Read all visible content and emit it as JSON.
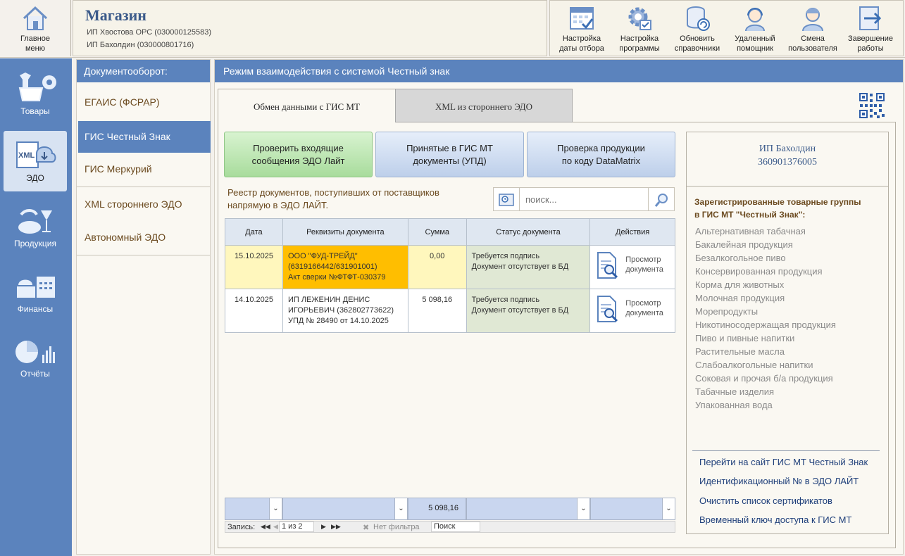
{
  "header": {
    "home_label": "Главное меню",
    "shop_title": "Магазин",
    "entity1": "ИП Хвостова ОРС (030000125583)",
    "entity2": "ИП Бахолдин (030000801716)",
    "toolbar": [
      {
        "label": "Настройка даты отбора",
        "icon": "calendar-icon"
      },
      {
        "label": "Настройка программы",
        "icon": "gear-icon"
      },
      {
        "label": "Обновить справочники",
        "icon": "database-refresh-icon"
      },
      {
        "label": "Удаленный помощник",
        "icon": "support-agent-icon"
      },
      {
        "label": "Смена пользователя",
        "icon": "user-switch-icon"
      },
      {
        "label": "Завершение работы",
        "icon": "exit-arrow-icon"
      }
    ]
  },
  "leftnav": [
    {
      "label": "Товары",
      "icon": "goods-basket-icon",
      "active": false
    },
    {
      "label": "ЭДО",
      "icon": "xml-edo-icon",
      "active": true
    },
    {
      "label": "Продукция",
      "icon": "products-icon",
      "active": false
    },
    {
      "label": "Финансы",
      "icon": "finance-register-icon",
      "active": false
    },
    {
      "label": "Отчёты",
      "icon": "reports-chart-icon",
      "active": false
    }
  ],
  "docpanel": {
    "title": "Документооборот:",
    "items": [
      "ЕГАИС (ФСРАР)",
      "ГИС Честный Знак",
      "ГИС Меркурий",
      "XML стороннего ЭДО",
      "Автономный ЭДО"
    ]
  },
  "main": {
    "title": "Режим взаимодействия с системой Честный знак",
    "tabs": [
      "Обмен данными с ГИС МТ",
      "XML из стороннего ЭДО"
    ],
    "buttons": {
      "check": [
        "Проверить входящие",
        "сообщения ЭДО Лайт"
      ],
      "accepted": [
        "Принятые в ГИС МТ",
        "документы (УПД)"
      ],
      "verify": [
        "Проверка продукции",
        "по коду DataMatrix"
      ]
    },
    "caption": [
      "Реестр документов, поступивших от поставщиков",
      "напрямую в ЭДО ЛАЙТ."
    ],
    "search_placeholder": "поиск...",
    "columns": [
      "Дата",
      "Реквизиты документа",
      "Сумма",
      "Статус документа",
      "Действия"
    ],
    "rows": [
      {
        "date": "15.10.2025",
        "req1": "ООО \"ФУД-ТРЕЙД\"",
        "req2": "(6319166442/631901001)",
        "req3": "Акт сверки №ФТФТ-030379",
        "sum": "0,00",
        "status1": "Требуется подпись",
        "status2": "Документ отсутствует в БД",
        "action1": "Просмотр",
        "action2": "документа"
      },
      {
        "date": "14.10.2025",
        "req1": "ИП ЛЕЖЕНИН ДЕНИС",
        "req2": "ИГОРЬЕВИЧ  (362802773622)",
        "req3": "УПД № 28490 от 14.10.2025",
        "sum": "5 098,16",
        "status1": "Требуется подпись",
        "status2": "Документ отсутствует в БД",
        "action1": "Просмотр",
        "action2": "документа"
      }
    ],
    "total_sum": "5 098,16",
    "nav": {
      "record_label": "Запись:",
      "position": "1 из 2",
      "no_filter": "Нет фильтра",
      "search": "Поиск"
    }
  },
  "info": {
    "org_name": "ИП Бахолдин",
    "org_inn": "360901376005",
    "groups_title": [
      "Зарегистрированные товарные группы",
      "в ГИС МТ \"Честный Знак\":"
    ],
    "groups": [
      "Альтернативная табачная",
      "Бакалейная продукция",
      "Безалкогольное пиво",
      "Консервированная продукция",
      "Корма для животных",
      "Молочная продукция",
      "Морепродукты",
      "Никотиносодержащая продукция",
      "Пиво и пивные напитки",
      "Растительные масла",
      "Слабоалкогольные напитки",
      "Соковая и прочая б/а продукция",
      "Табачные изделия",
      "Упакованная вода"
    ],
    "links": [
      "Перейти на сайт ГИС МТ Честный Знак",
      "Идентификационный № в ЭДО ЛАЙТ",
      "Очистить список сертификатов",
      "Временный ключ доступа к ГИС МТ"
    ]
  },
  "colors": {
    "accent": "#5b83bd",
    "brand_text": "#3b5a8a",
    "highlight": "#ffbe00",
    "status_bg": "#e0e8d4"
  }
}
